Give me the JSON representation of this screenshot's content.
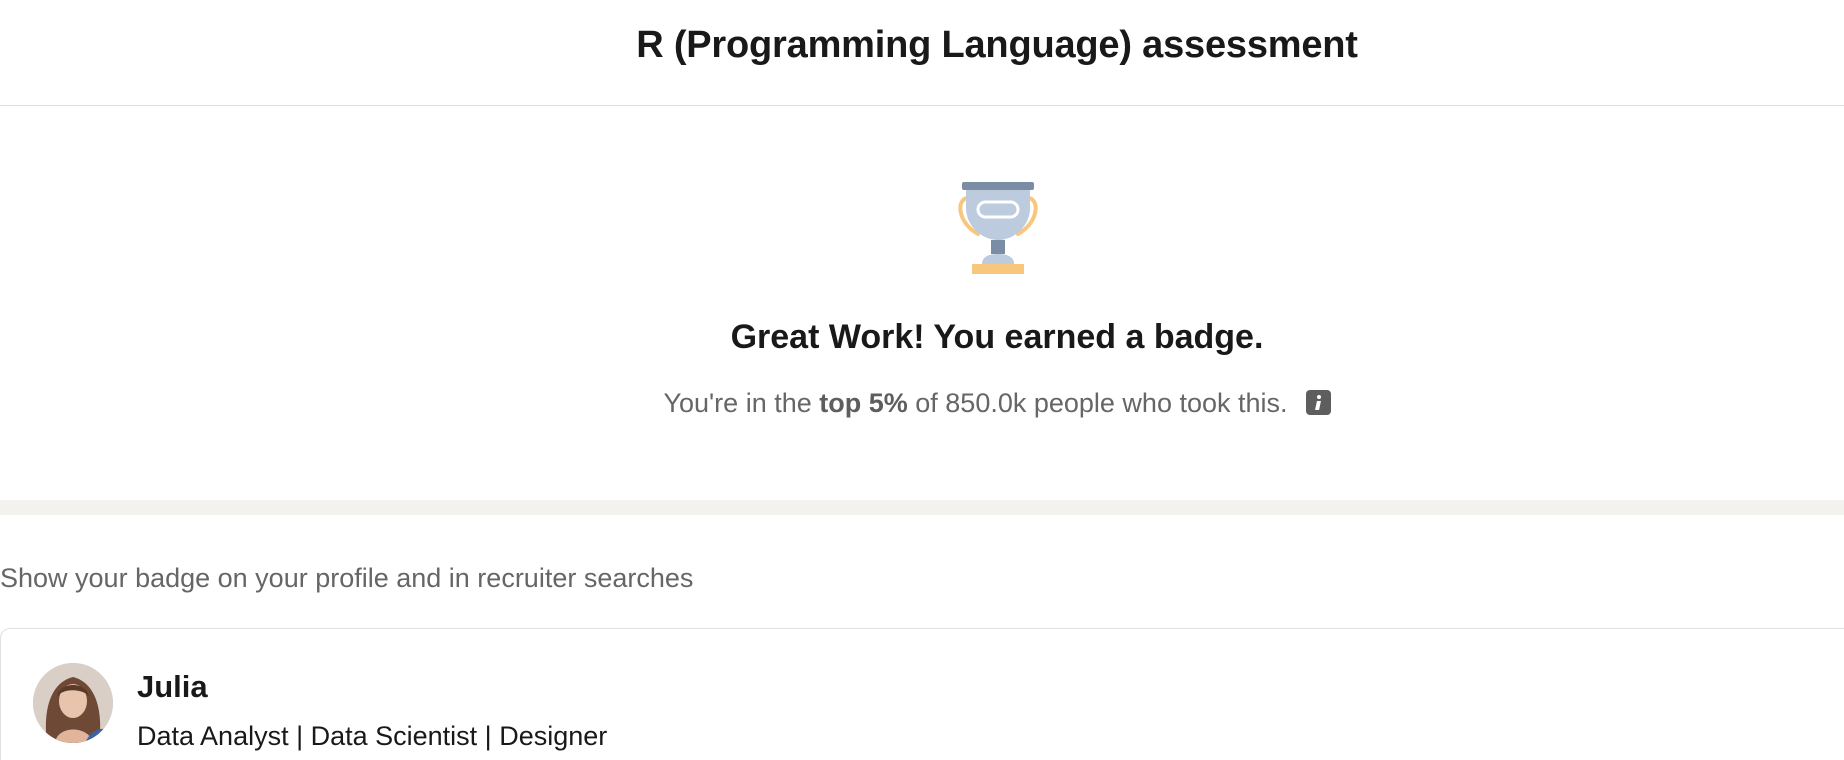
{
  "header": {
    "title": "R (Programming Language) assessment"
  },
  "result": {
    "trophy_icon": "trophy-icon",
    "heading": "Great Work! You earned a badge.",
    "sub_prefix": "You're in the ",
    "sub_rank": "top 5%",
    "sub_suffix": " of 850.0k people who took this.",
    "info_icon": "info-icon"
  },
  "badge_section": {
    "label": "Show your badge on your profile and in recruiter searches"
  },
  "profile": {
    "name": "Julia",
    "headline": "Data Analyst | Data Scientist | Designer",
    "avatar_icon": "avatar"
  },
  "colors": {
    "text_primary": "#191919",
    "text_secondary": "#666666",
    "band": "#f3f2ee",
    "trophy_silver": "#bccbdd",
    "trophy_gold": "#f8c77e"
  }
}
